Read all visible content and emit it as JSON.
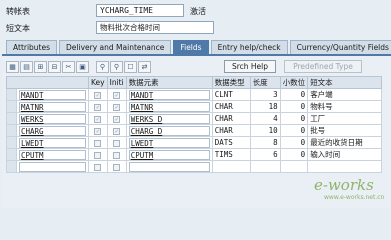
{
  "header": {
    "table_label": "转帐表",
    "table_name": "YCHARG_TIME",
    "status": "激活",
    "desc_label": "短文本",
    "description": "物料批次合格时间"
  },
  "tabs": [
    {
      "label": "Attributes",
      "active": false
    },
    {
      "label": "Delivery and Maintenance",
      "active": false
    },
    {
      "label": "Fields",
      "active": true
    },
    {
      "label": "Entry help/check",
      "active": false
    },
    {
      "label": "Currency/Quantity Fields",
      "active": false
    }
  ],
  "toolbar": {
    "icons": [
      "table-icon",
      "copy-rows-icon",
      "insert-row-icon",
      "delete-row-icon",
      "cut-icon",
      "paste-icon",
      "find-icon",
      "find-next-icon",
      "new-rows-icon",
      "transfer-icon"
    ],
    "srch_help_label": "Srch Help",
    "predefined_type_label": "Predefined Type"
  },
  "columns": [
    "",
    "Key",
    "Initi",
    "数据元素",
    "数据类型",
    "长度",
    "小数位",
    "短文本"
  ],
  "rows": [
    {
      "field": "MANDT",
      "key": true,
      "init": true,
      "element": "MANDT",
      "type": "CLNT",
      "len": "3",
      "dec": "0",
      "text": "客户端"
    },
    {
      "field": "MATNR",
      "key": true,
      "init": true,
      "element": "MATNR",
      "type": "CHAR",
      "len": "18",
      "dec": "0",
      "text": "物料号"
    },
    {
      "field": "WERKS",
      "key": true,
      "init": true,
      "element": "WERKS_D",
      "type": "CHAR",
      "len": "4",
      "dec": "0",
      "text": "工厂"
    },
    {
      "field": "CHARG",
      "key": true,
      "init": true,
      "element": "CHARG_D",
      "type": "CHAR",
      "len": "10",
      "dec": "0",
      "text": "批号"
    },
    {
      "field": "LWEDT",
      "key": false,
      "init": false,
      "element": "LWEDT",
      "type": "DATS",
      "len": "8",
      "dec": "0",
      "text": "最近的收货日期"
    },
    {
      "field": "CPUTM",
      "key": false,
      "init": false,
      "element": "CPUTM",
      "type": "TIMS",
      "len": "6",
      "dec": "0",
      "text": "输入时间"
    },
    {
      "field": "",
      "key": false,
      "init": false,
      "element": "",
      "type": "",
      "len": "",
      "dec": "",
      "text": ""
    }
  ],
  "watermark": {
    "logo": "e-works",
    "url": "www.e-works.net.cn"
  },
  "colors": {
    "active_tab": "#4f79a7",
    "background": "#e6edf3"
  }
}
